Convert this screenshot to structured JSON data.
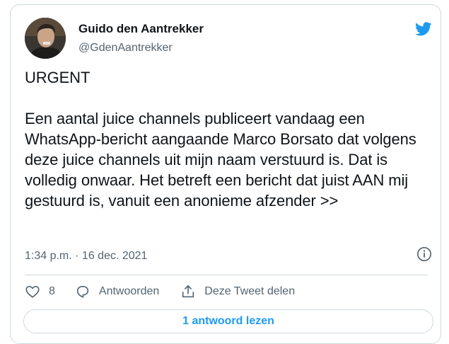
{
  "author": {
    "name": "Guido den Aantrekker",
    "handle": "@GdenAantrekker"
  },
  "tweet": {
    "text": "URGENT\n\nEen aantal juice channels publiceert vandaag een WhatsApp-bericht aangaande Marco Borsato dat volgens deze juice channels uit mijn naam verstuurd is. Dat is volledig onwaar. Het betreft een bericht dat juist AAN mij gestuurd is, vanuit een anonieme afzender >>",
    "timestamp": "1:34 p.m. · 16 dec. 2021"
  },
  "actions": {
    "like_count": "8",
    "reply_label": "Antwoorden",
    "share_label": "Deze Tweet delen"
  },
  "read_replies_label": "1 antwoord lezen",
  "colors": {
    "accent": "#1d9bf0",
    "secondary_text": "#536471",
    "border": "#cfd9de"
  },
  "icons": [
    "twitter-bird-icon",
    "info-icon",
    "heart-icon",
    "reply-bubble-icon",
    "share-icon"
  ]
}
